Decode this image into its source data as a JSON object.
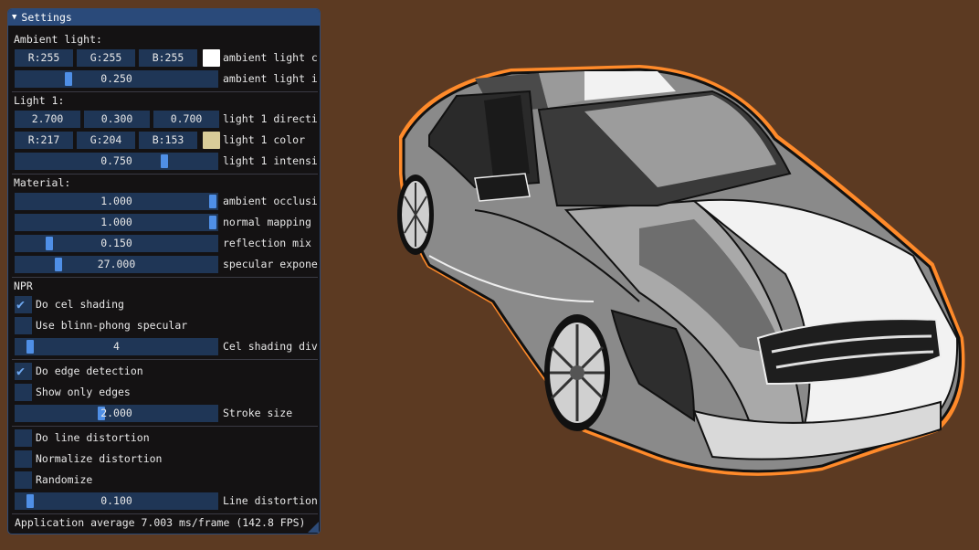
{
  "colors": {
    "background": "#5c3a22",
    "accent": "#4f8fe6",
    "frame": "#1f3656"
  },
  "window": {
    "title": "Settings",
    "collapse_icon": "triangle-down-icon"
  },
  "ambient": {
    "header": "Ambient light:",
    "color": {
      "r": "R:255",
      "g": "G:255",
      "b": "B:255",
      "swatch": "#ffffff",
      "label": "ambient light c"
    },
    "intensity": {
      "value": "0.250",
      "fraction": 0.25,
      "label": "ambient light i"
    }
  },
  "light1": {
    "header": "Light 1:",
    "direction": {
      "x": "2.700",
      "y": "0.300",
      "z": "0.700",
      "label": "light 1 directi"
    },
    "color": {
      "r": "R:217",
      "g": "G:204",
      "b": "B:153",
      "swatch": "#d9cc99",
      "label": "light 1 color"
    },
    "intensity": {
      "value": "0.750",
      "fraction": 0.75,
      "label": "light 1 intensi"
    }
  },
  "material": {
    "header": "Material:",
    "ambient_occlusion": {
      "value": "1.000",
      "fraction": 1.0,
      "label": "ambient occlusi"
    },
    "normal_mapping": {
      "value": "1.000",
      "fraction": 1.0,
      "label": "normal mapping"
    },
    "reflection_mix": {
      "value": "0.150",
      "fraction": 0.15,
      "label": "reflection mix"
    },
    "specular_exponent": {
      "value": "27.000",
      "fraction": 0.2,
      "label": "specular expone"
    }
  },
  "npr": {
    "header": "NPR",
    "cel_shading": {
      "label": "Do cel shading",
      "checked": true
    },
    "blinn_phong": {
      "label": "Use blinn-phong specular",
      "checked": false
    },
    "cel_divisions": {
      "value": "4",
      "fraction": 0.05,
      "label": "Cel shading div"
    },
    "edge_detection": {
      "label": "Do edge detection",
      "checked": true
    },
    "only_edges": {
      "label": "Show only edges",
      "checked": false
    },
    "stroke_size": {
      "value": "2.000",
      "fraction": 0.42,
      "label": "Stroke size"
    },
    "line_distortion": {
      "label": "Do line distortion",
      "checked": false
    },
    "normalize_distortion": {
      "label": "Normalize distortion",
      "checked": false
    },
    "randomize": {
      "label": "Randomize",
      "checked": false
    },
    "distortion_amount": {
      "value": "0.100",
      "fraction": 0.05,
      "label": "Line distortion"
    }
  },
  "status": {
    "fps_text": "Application average 7.003 ms/frame (142.8 FPS)"
  }
}
